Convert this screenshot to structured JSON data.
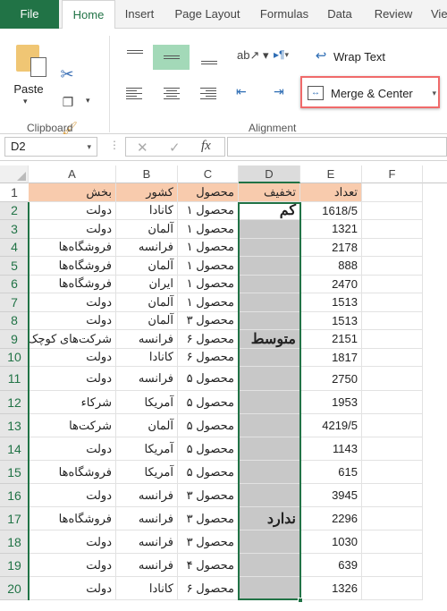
{
  "tabs": [
    "File",
    "Home",
    "Insert",
    "Page Layout",
    "Formulas",
    "Data",
    "Review",
    "View"
  ],
  "ribbon": {
    "paste_label": "Paste",
    "clipboard_group": "Clipboard",
    "alignment_group": "Alignment",
    "wrap_text": "Wrap Text",
    "merge_center": "Merge & Center"
  },
  "formula_bar": {
    "name_box": "D2",
    "fx": "fx",
    "value": ""
  },
  "accent": "#217346",
  "header_fill": "#f8cbad",
  "highlight_color": "#f06a6a",
  "columns": [
    "A",
    "B",
    "C",
    "D",
    "E",
    "F"
  ],
  "header_row": {
    "A": "بخش",
    "B": "کشور",
    "C": "محصول",
    "D": "تخفیف",
    "E": "تعداد"
  },
  "discount_labels": {
    "low": "کم",
    "medium": "متوسط",
    "none": "ندارد"
  },
  "rows": [
    {
      "n": "2",
      "A": "دولت",
      "B": "کانادا",
      "C": "محصول ۱",
      "E": "1618/5"
    },
    {
      "n": "3",
      "A": "دولت",
      "B": "آلمان",
      "C": "محصول ۱",
      "E": "1321"
    },
    {
      "n": "4",
      "A": "فروشگاه‌ها",
      "B": "فرانسه",
      "C": "محصول ۱",
      "E": "2178"
    },
    {
      "n": "5",
      "A": "فروشگاه‌ها",
      "B": "آلمان",
      "C": "محصول ۱",
      "E": "888"
    },
    {
      "n": "6",
      "A": "فروشگاه‌ها",
      "B": "ایران",
      "C": "محصول ۱",
      "E": "2470"
    },
    {
      "n": "7",
      "A": "دولت",
      "B": "آلمان",
      "C": "محصول ۱",
      "E": "1513"
    },
    {
      "n": "8",
      "A": "دولت",
      "B": "آلمان",
      "C": "محصول ۳",
      "E": "1513"
    },
    {
      "n": "9",
      "A": "شرکت‌های کوچک",
      "B": "فرانسه",
      "C": "محصول ۶",
      "E": "2151"
    },
    {
      "n": "10",
      "A": "دولت",
      "B": "کانادا",
      "C": "محصول ۶",
      "E": "1817"
    },
    {
      "n": "11",
      "A": "دولت",
      "B": "فرانسه",
      "C": "محصول ۵",
      "E": "2750"
    },
    {
      "n": "12",
      "A": "شرکاء",
      "B": "آمریکا",
      "C": "محصول ۵",
      "E": "1953"
    },
    {
      "n": "13",
      "A": "شرکت‌ها",
      "B": "آلمان",
      "C": "محصول ۵",
      "E": "4219/5"
    },
    {
      "n": "14",
      "A": "دولت",
      "B": "آمریکا",
      "C": "محصول ۵",
      "E": "1143"
    },
    {
      "n": "15",
      "A": "فروشگاه‌ها",
      "B": "آمریکا",
      "C": "محصول ۵",
      "E": "615"
    },
    {
      "n": "16",
      "A": "دولت",
      "B": "فرانسه",
      "C": "محصول ۳",
      "E": "3945"
    },
    {
      "n": "17",
      "A": "فروشگاه‌ها",
      "B": "فرانسه",
      "C": "محصول ۳",
      "E": "2296"
    },
    {
      "n": "18",
      "A": "دولت",
      "B": "فرانسه",
      "C": "محصول ۳",
      "E": "1030"
    },
    {
      "n": "19",
      "A": "دولت",
      "B": "فرانسه",
      "C": "محصول ۴",
      "E": "639"
    },
    {
      "n": "20",
      "A": "دولت",
      "B": "کانادا",
      "C": "محصول ۶",
      "E": "1326"
    }
  ]
}
